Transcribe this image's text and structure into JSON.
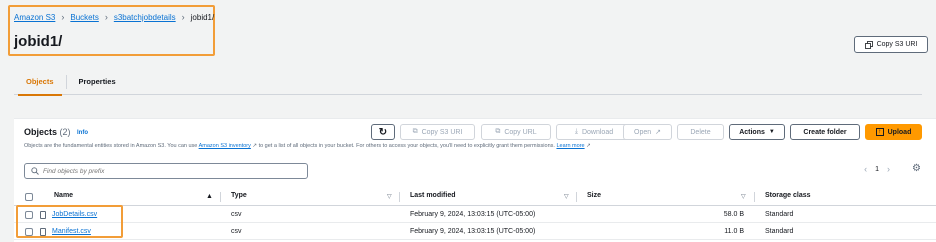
{
  "breadcrumb": {
    "items": [
      "Amazon S3",
      "Buckets",
      "s3batchjobdetails"
    ],
    "current": "jobid1/"
  },
  "page_title": "jobid1/",
  "header": {
    "copy_s3_uri_label": "Copy S3 URI"
  },
  "tabs": [
    {
      "label": "Objects",
      "active": true
    },
    {
      "label": "Properties",
      "active": false
    }
  ],
  "objects": {
    "title": "Objects",
    "count": "(2)",
    "info_label": "Info",
    "description_prefix": "Objects are the fundamental entities stored in Amazon S3. You can use",
    "inventory_link": "Amazon S3 inventory",
    "description_middle": "to get a list of all objects in your bucket. For others to access your objects, you'll need to explicitly grant them permissions.",
    "learn_more": "Learn more"
  },
  "toolbar": {
    "refresh_icon": "refresh-icon",
    "copy_s3_uri": "Copy S3 URI",
    "copy_url": "Copy URL",
    "download": "Download",
    "open": "Open",
    "delete": "Delete",
    "actions": "Actions",
    "create_folder": "Create folder",
    "upload": "Upload"
  },
  "search": {
    "placeholder": "Find objects by prefix"
  },
  "pagination": {
    "page": "1"
  },
  "table": {
    "columns": [
      "Name",
      "Type",
      "Last modified",
      "Size",
      "Storage class"
    ],
    "rows": [
      {
        "name": "JobDetails.csv",
        "type": "csv",
        "modified": "February 9, 2024, 13:03:15 (UTC-05:00)",
        "size": "58.0 B",
        "storage": "Standard"
      },
      {
        "name": "Manifest.csv",
        "type": "csv",
        "modified": "February 9, 2024, 13:03:15 (UTC-05:00)",
        "size": "11.0 B",
        "storage": "Standard"
      }
    ]
  },
  "colors": {
    "accent": "#ff9900",
    "link": "#0972d3",
    "highlight": "#f29d38"
  }
}
